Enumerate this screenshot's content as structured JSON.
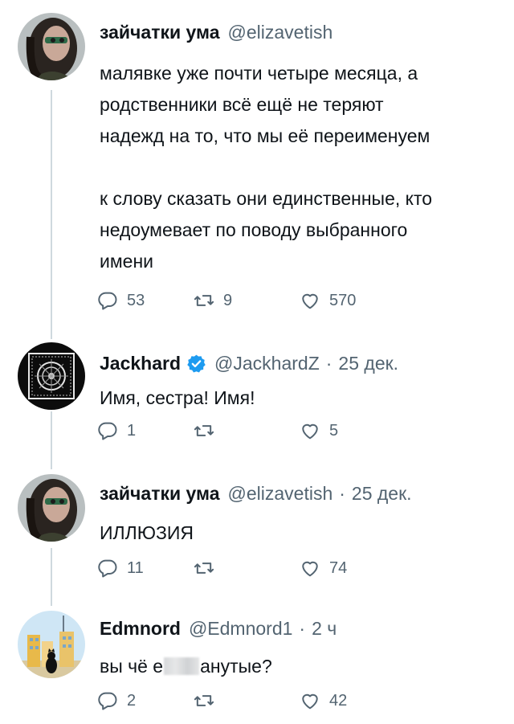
{
  "tweets": [
    {
      "name": "зайчатки ума",
      "handle": "@elizavetish",
      "time": "",
      "text": "малявке уже почти четыре месяца, а\nродственники всё ещё не теряют\nнадежд на то, что мы её переименуем\n\nк слову сказать они единственные, кто\nнедоумевает по поводу выбранного\nимени",
      "replies": "53",
      "retweets": "9",
      "likes": "570"
    },
    {
      "name": "Jackhard",
      "handle": "@JackhardZ",
      "time": "25 дек.",
      "verified": true,
      "text": "Имя, сестра! Имя!",
      "replies": "1",
      "retweets": "",
      "likes": "5"
    },
    {
      "name": "зайчатки ума",
      "handle": "@elizavetish",
      "time": "25 дек.",
      "text": "ИЛЛЮЗИЯ",
      "replies": "11",
      "retweets": "",
      "likes": "74"
    },
    {
      "name": "Edmnord",
      "handle": "@Edmnord1",
      "time": "2 ч",
      "text_before": "вы чё е",
      "text_after": "анутые?",
      "replies": "2",
      "retweets": "",
      "likes": "42"
    }
  ],
  "icons": {
    "reply": "reply-icon",
    "retweet": "retweet-icon",
    "like": "heart-icon",
    "verified": "verified-badge-icon"
  },
  "colors": {
    "muted": "#536471",
    "verified": "#1d9bf0",
    "thread_line": "#cfd9de"
  }
}
